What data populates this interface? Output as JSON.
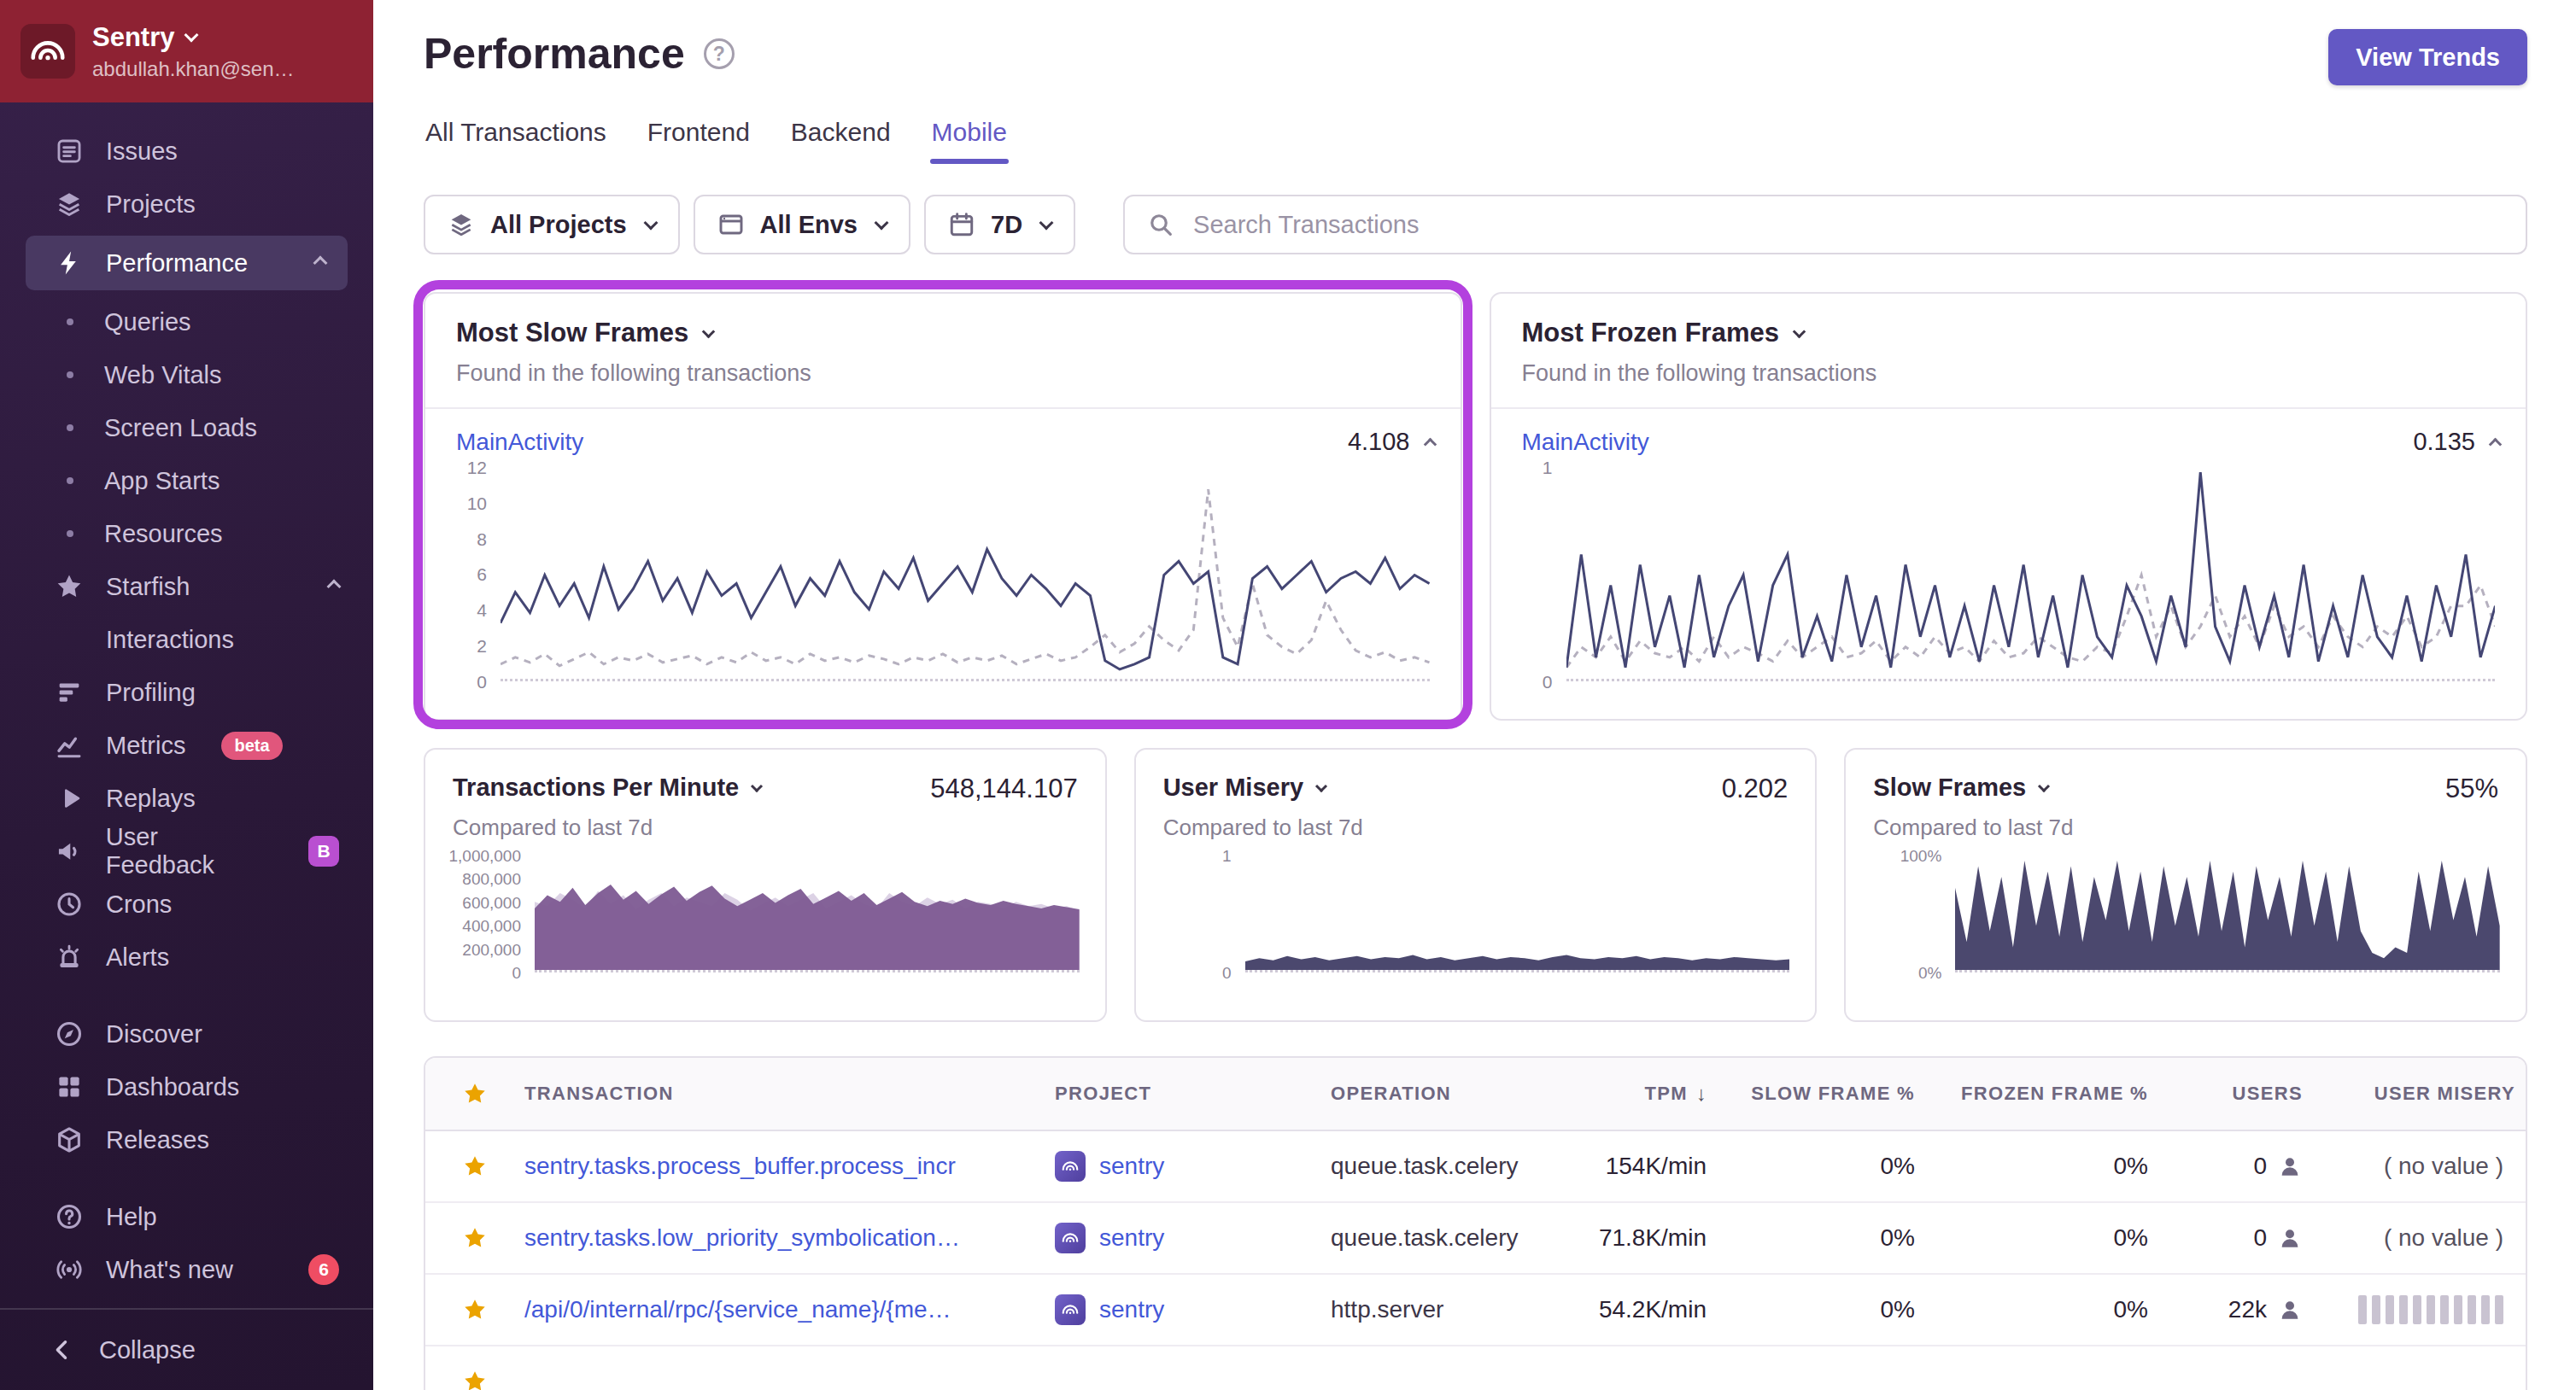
{
  "colors": {
    "accent": "#6358c4",
    "annotation": "#b341de",
    "chart_line": "#444674",
    "link": "#4358d8",
    "star": "#eba300",
    "sidebar_red": "#8e2233"
  },
  "sidebar": {
    "org": {
      "name": "Sentry",
      "email": "abdullah.khan@sen…"
    },
    "items": [
      {
        "label": "Issues",
        "icon": "issues"
      },
      {
        "label": "Projects",
        "icon": "projects"
      },
      {
        "label": "Performance",
        "icon": "performance",
        "active": true,
        "expanded": true
      },
      {
        "label": "Queries",
        "sub": true
      },
      {
        "label": "Web Vitals",
        "sub": true
      },
      {
        "label": "Screen Loads",
        "sub": true
      },
      {
        "label": "App Starts",
        "sub": true
      },
      {
        "label": "Resources",
        "sub": true
      },
      {
        "label": "Starfish",
        "icon": "star",
        "expanded": true
      },
      {
        "label": "Interactions",
        "indent": true
      },
      {
        "label": "Profiling",
        "icon": "profiling"
      },
      {
        "label": "Metrics",
        "icon": "metrics",
        "badge": "beta",
        "badge_style": "pill"
      },
      {
        "label": "Replays",
        "icon": "replays"
      },
      {
        "label": "User Feedback",
        "icon": "feedback",
        "badge": "B",
        "badge_style": "square"
      },
      {
        "label": "Crons",
        "icon": "crons"
      },
      {
        "label": "Alerts",
        "icon": "alerts"
      },
      {
        "label": "Discover",
        "icon": "discover",
        "gap": true
      },
      {
        "label": "Dashboards",
        "icon": "dashboards"
      },
      {
        "label": "Releases",
        "icon": "releases"
      },
      {
        "label": "Help",
        "icon": "help",
        "gap": true
      },
      {
        "label": "What's new",
        "icon": "whats-new",
        "badge": "6",
        "badge_style": "count"
      }
    ],
    "collapse_label": "Collapse"
  },
  "header": {
    "title": "Performance",
    "view_trends": "View Trends"
  },
  "tabs": [
    {
      "label": "All Transactions"
    },
    {
      "label": "Frontend"
    },
    {
      "label": "Backend"
    },
    {
      "label": "Mobile",
      "active": true
    }
  ],
  "filters": {
    "projects": "All Projects",
    "environments": "All Envs",
    "date_range": "7D",
    "search_placeholder": "Search Transactions"
  },
  "widgets": {
    "most_slow_frames": {
      "title": "Most Slow Frames",
      "subtitle": "Found in the following transactions",
      "transaction": "MainActivity",
      "value": "4.108",
      "y_ticks": [
        "12",
        "10",
        "8",
        "6",
        "4",
        "2",
        "0"
      ]
    },
    "most_frozen_frames": {
      "title": "Most Frozen Frames",
      "subtitle": "Found in the following transactions",
      "transaction": "MainActivity",
      "value": "0.135",
      "y_ticks": [
        "1",
        "0"
      ]
    },
    "tpm": {
      "title": "Transactions Per Minute",
      "value": "548,144.107",
      "subtitle": "Compared to last 7d",
      "y_ticks": [
        "1,000,000",
        "800,000",
        "600,000",
        "400,000",
        "200,000",
        "0"
      ]
    },
    "user_misery": {
      "title": "User Misery",
      "value": "0.202",
      "subtitle": "Compared to last 7d",
      "y_ticks": [
        "1",
        "0"
      ]
    },
    "slow_frames": {
      "title": "Slow Frames",
      "value": "55%",
      "subtitle": "Compared to last 7d",
      "y_ticks": [
        "100%",
        "0%"
      ]
    }
  },
  "chart_data": {
    "most_slow_frames": {
      "type": "line",
      "title": "Most Slow Frames",
      "series_label": "MainActivity",
      "ylim": [
        0,
        12
      ],
      "max": 12,
      "color": "#444674",
      "comparison_color": "#b5b0bf",
      "values": [
        3.2,
        5,
        3.8,
        6,
        4.2,
        5.5,
        3.5,
        6.5,
        4,
        5.2,
        6.8,
        4.5,
        5.8,
        3.8,
        6.2,
        4.8,
        5.5,
        3.5,
        5,
        6.5,
        4.2,
        5.8,
        4.8,
        6.8,
        5,
        4,
        6.2,
        5.2,
        7,
        4.5,
        5.5,
        6.5,
        5,
        7.5,
        5.8,
        4.8,
        6,
        5.2,
        4.2,
        5.5,
        4.8,
        1,
        0.5,
        0.8,
        1.2,
        6,
        6.8,
        5.5,
        6.2,
        1.2,
        0.8,
        5.8,
        6.5,
        5.2,
        6,
        6.8,
        5,
        5.8,
        6.2,
        5.5,
        7,
        5.2,
        6,
        5.5
      ],
      "comparison": [
        0.8,
        1.2,
        0.9,
        1.4,
        0.7,
        1.1,
        1.5,
        0.8,
        1.2,
        1,
        1.4,
        0.9,
        1.1,
        1.3,
        0.8,
        1.2,
        0.9,
        1.5,
        1,
        1.2,
        0.8,
        1.4,
        1,
        1.2,
        0.9,
        1.3,
        1.1,
        0.8,
        1.2,
        1,
        1.4,
        0.9,
        1.2,
        1,
        1.3,
        0.8,
        1.1,
        1.4,
        1,
        1.2,
        1.8,
        2.5,
        1.5,
        2,
        3,
        2.2,
        1.6,
        2.8,
        11,
        3.5,
        1.8,
        5.5,
        2.5,
        1.8,
        1.4,
        2.2,
        4.5,
        2.8,
        1.6,
        1.2,
        1.5,
        1,
        1.2,
        0.9
      ]
    },
    "most_frozen_frames": {
      "type": "line",
      "title": "Most Frozen Frames",
      "series_label": "MainActivity",
      "ylim": [
        0,
        1
      ],
      "max": 1,
      "color": "#444674",
      "comparison_color": "#b5b0bf",
      "values": [
        0.05,
        0.6,
        0.1,
        0.45,
        0.05,
        0.55,
        0.15,
        0.4,
        0.05,
        0.5,
        0.1,
        0.35,
        0.5,
        0.08,
        0.45,
        0.6,
        0.1,
        0.3,
        0.08,
        0.5,
        0.15,
        0.4,
        0.05,
        0.55,
        0.2,
        0.45,
        0.1,
        0.35,
        0.08,
        0.45,
        0.15,
        0.55,
        0.1,
        0.4,
        0.05,
        0.5,
        0.2,
        0.1,
        0.45,
        0.3,
        0.08,
        0.4,
        0.15,
        1,
        0.25,
        0.08,
        0.45,
        0.15,
        0.4,
        0.1,
        0.55,
        0.08,
        0.35,
        0.1,
        0.5,
        0.2,
        0.1,
        0.4,
        0.08,
        0.45,
        0.2,
        0.6,
        0.1,
        0.35
      ],
      "comparison": [
        0.05,
        0.15,
        0.1,
        0.2,
        0.08,
        0.18,
        0.12,
        0.1,
        0.15,
        0.08,
        0.2,
        0.1,
        0.15,
        0.12,
        0.08,
        0.18,
        0.1,
        0.15,
        0.2,
        0.1,
        0.12,
        0.18,
        0.08,
        0.15,
        0.1,
        0.2,
        0.12,
        0.15,
        0.08,
        0.18,
        0.1,
        0.12,
        0.2,
        0.15,
        0.1,
        0.08,
        0.15,
        0.12,
        0.3,
        0.5,
        0.2,
        0.35,
        0.15,
        0.25,
        0.4,
        0.2,
        0.3,
        0.15,
        0.35,
        0.2,
        0.25,
        0.15,
        0.3,
        0.2,
        0.15,
        0.25,
        0.2,
        0.3,
        0.15,
        0.2,
        0.35,
        0.35,
        0.45,
        0.25
      ]
    },
    "tpm": {
      "type": "area",
      "title": "Transactions Per Minute",
      "ylim": [
        0,
        1000000
      ],
      "max": 1000000,
      "color": "#7d5a92",
      "comparison_color": "#cdbfda",
      "values": [
        560000,
        680000,
        620000,
        750000,
        590000,
        700000,
        780000,
        640000,
        720000,
        600000,
        690000,
        760000,
        630000,
        710000,
        770000,
        650000,
        580000,
        640000,
        700000,
        610000,
        680000,
        740000,
        600000,
        660000,
        720000,
        630000,
        700000,
        590000,
        650000,
        710000,
        620000,
        580000,
        630000,
        600000,
        650000,
        610000,
        590000,
        630000,
        600000,
        580000,
        560000,
        590000,
        570000,
        550000
      ],
      "comparison": [
        620000,
        580000,
        700000,
        640000,
        560000,
        720000,
        600000,
        680000,
        550000,
        640000,
        700000,
        580000,
        660000,
        620000,
        580000,
        700000,
        640000,
        540000,
        600000,
        660000,
        580000,
        640000,
        700000,
        560000,
        620000,
        680000,
        600000,
        560000,
        700000,
        620000,
        580000,
        660000,
        600000,
        640000,
        560000,
        620000,
        600000,
        560000,
        620000,
        580000,
        600000,
        560000,
        580000,
        540000
      ]
    },
    "user_misery": {
      "type": "area",
      "title": "User Misery",
      "ylim": [
        0,
        1
      ],
      "max": 1,
      "color": "#413e66",
      "values": [
        0.07,
        0.1,
        0.08,
        0.12,
        0.09,
        0.11,
        0.08,
        0.1,
        0.12,
        0.09,
        0.11,
        0.1,
        0.13,
        0.09,
        0.11,
        0.08,
        0.1,
        0.12,
        0.09,
        0.11,
        0.1,
        0.08,
        0.11,
        0.13,
        0.1,
        0.09,
        0.11,
        0.1,
        0.12,
        0.09,
        0.11,
        0.1,
        0.08,
        0.1,
        0.09,
        0.11,
        0.1,
        0.09,
        0.08,
        0.09
      ]
    },
    "slow_frames": {
      "type": "area",
      "title": "Slow Frames",
      "ylim": [
        0,
        100
      ],
      "max": 100,
      "color": "#413e66",
      "values": [
        75,
        25,
        95,
        35,
        85,
        20,
        100,
        40,
        90,
        30,
        95,
        25,
        85,
        45,
        100,
        35,
        90,
        25,
        95,
        40,
        85,
        30,
        100,
        35,
        90,
        20,
        95,
        45,
        85,
        30,
        100,
        40,
        90,
        25,
        95,
        35,
        15,
        10,
        20,
        15,
        90,
        35,
        100,
        45,
        85,
        30,
        95,
        40
      ]
    }
  },
  "table": {
    "columns": [
      {
        "name": "favorite",
        "label": "",
        "icon": "star"
      },
      {
        "label": "TRANSACTION",
        "align": "left"
      },
      {
        "label": "PROJECT",
        "align": "left"
      },
      {
        "label": "OPERATION",
        "align": "left"
      },
      {
        "label": "TPM",
        "align": "right",
        "sorted": "desc"
      },
      {
        "label": "SLOW FRAME %",
        "align": "right"
      },
      {
        "label": "FROZEN FRAME %",
        "align": "right"
      },
      {
        "label": "USERS",
        "align": "right"
      },
      {
        "label": "USER MISERY",
        "align": "right"
      }
    ],
    "rows": [
      {
        "transaction": "sentry.tasks.process_buffer.process_incr",
        "project": "sentry",
        "operation": "queue.task.celery",
        "tpm": "154K/min",
        "slow_frame": "0%",
        "frozen_frame": "0%",
        "users": "0",
        "user_misery": "( no value )",
        "misery_type": "text"
      },
      {
        "transaction": "sentry.tasks.low_priority_symbolication…",
        "project": "sentry",
        "operation": "queue.task.celery",
        "tpm": "71.8K/min",
        "slow_frame": "0%",
        "frozen_frame": "0%",
        "users": "0",
        "user_misery": "( no value )",
        "misery_type": "text"
      },
      {
        "transaction": "/api/0/internal/rpc/{service_name}/{me…",
        "project": "sentry",
        "operation": "http.server",
        "tpm": "54.2K/min",
        "slow_frame": "0%",
        "frozen_frame": "0%",
        "users": "22k",
        "user_misery": "",
        "misery_type": "bars"
      },
      {
        "transaction": "",
        "project": "",
        "operation": "",
        "tpm": "",
        "slow_frame": "",
        "frozen_frame": "",
        "users": "",
        "user_misery": "",
        "misery_type": "none",
        "partial": true
      }
    ]
  }
}
